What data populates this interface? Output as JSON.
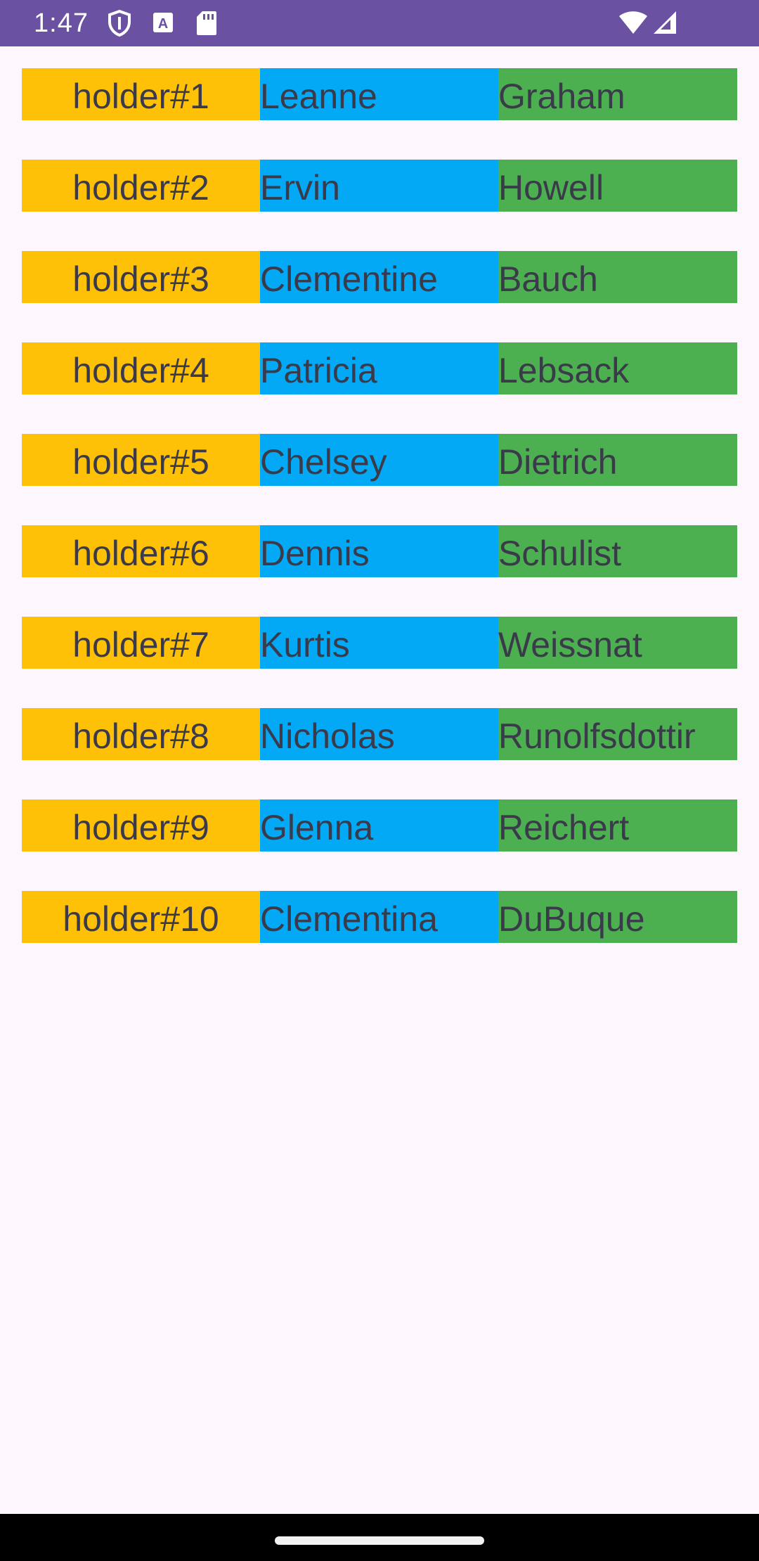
{
  "status_bar": {
    "time": "1:47",
    "left_icons": [
      "shield-icon",
      "text-a-icon",
      "sd-card-icon"
    ],
    "right_icons": [
      "wifi-icon",
      "cell-signal-icon"
    ],
    "background_color": "#6a51a2"
  },
  "colors": {
    "holder_column": "#ffc107",
    "first_name_column": "#03a9f4",
    "last_name_column": "#4caf50",
    "text": "#3a3a4a",
    "page_background": "#fdf6fd"
  },
  "rows": [
    {
      "holder": "holder#1",
      "first_name": "Leanne",
      "last_name": "Graham"
    },
    {
      "holder": "holder#2",
      "first_name": "Ervin",
      "last_name": "Howell"
    },
    {
      "holder": "holder#3",
      "first_name": "Clementine",
      "last_name": "Bauch"
    },
    {
      "holder": "holder#4",
      "first_name": "Patricia",
      "last_name": "Lebsack"
    },
    {
      "holder": "holder#5",
      "first_name": "Chelsey",
      "last_name": "Dietrich"
    },
    {
      "holder": "holder#6",
      "first_name": "Dennis",
      "last_name": "Schulist"
    },
    {
      "holder": "holder#7",
      "first_name": "Kurtis",
      "last_name": "Weissnat"
    },
    {
      "holder": "holder#8",
      "first_name": "Nicholas",
      "last_name": "Runolfsdottir"
    },
    {
      "holder": "holder#9",
      "first_name": "Glenna",
      "last_name": "Reichert"
    },
    {
      "holder": "holder#10",
      "first_name": "Clementina",
      "last_name": "DuBuque"
    }
  ]
}
